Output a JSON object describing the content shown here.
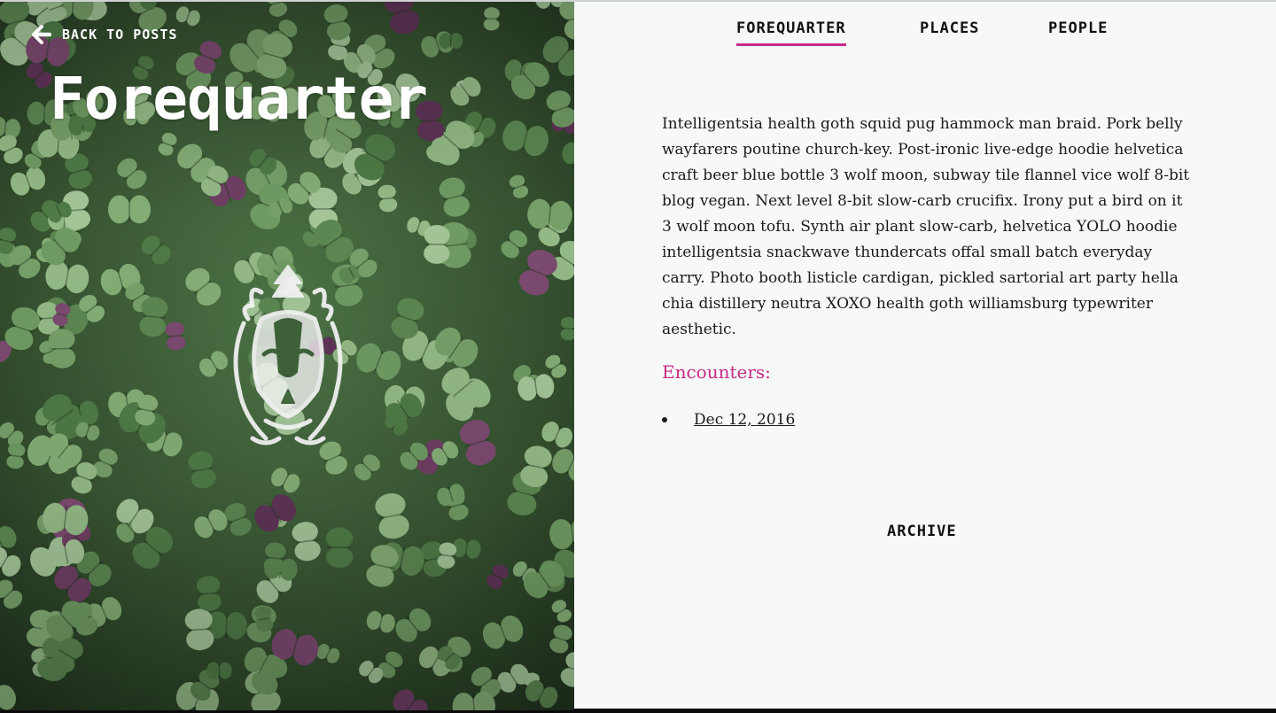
{
  "hero": {
    "back_label": "BACK TO POSTS",
    "title": "Forequarter",
    "image_description": "green clover microgreens with purple leaves",
    "emblem_icon": "badger-crest-logo-icon"
  },
  "nav": {
    "items": [
      {
        "label": "FOREQUARTER",
        "active": true
      },
      {
        "label": "PLACES",
        "active": false
      },
      {
        "label": "PEOPLE",
        "active": false
      }
    ]
  },
  "main": {
    "body": "Intelligentsia health goth squid pug hammock man braid. Pork belly wayfarers poutine church-key. Post-ironic live-edge hoodie helvetica craft beer blue bottle 3 wolf moon, subway tile flannel vice wolf 8-bit blog vegan. Next level 8-bit slow-carb crucifix. Irony put a bird on it 3 wolf moon tofu. Synth air plant slow-carb, helvetica YOLO hoodie intelligentsia snackwave thundercats offal small batch everyday carry. Photo booth listicle cardigan, pickled sartorial art party hella chia distillery neutra XOXO health goth williamsburg typewriter aesthetic.",
    "encounters_heading": "Encounters:",
    "encounters": [
      {
        "label": "Dec 12, 2016"
      }
    ],
    "archive_label": "ARCHIVE"
  },
  "colors": {
    "accent": "#c92b86",
    "panel_background": "#f7f8f8",
    "text": "#1a1a1a"
  }
}
